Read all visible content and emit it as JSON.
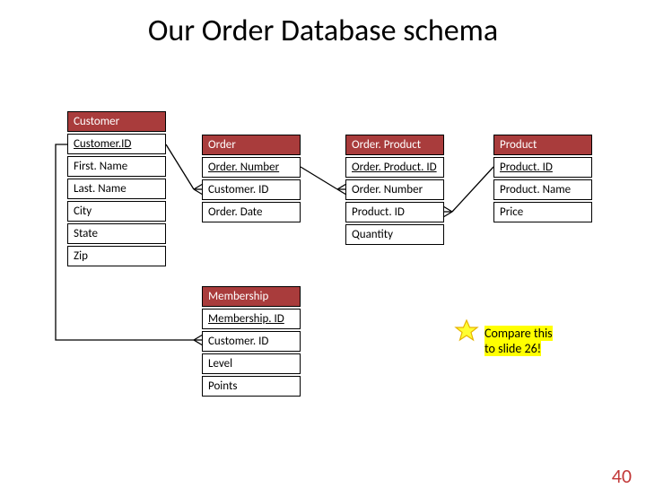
{
  "title": "Our Order Database schema",
  "tables": {
    "customer": {
      "name": "Customer",
      "fields": [
        "Customer.ID",
        "First. Name",
        "Last. Name",
        "City",
        "State",
        "Zip"
      ]
    },
    "order": {
      "name": "Order",
      "fields": [
        "Order. Number",
        "Customer. ID",
        "Order. Date"
      ]
    },
    "orderproduct": {
      "name": "Order. Product",
      "fields": [
        "Order. Product. ID",
        "Order. Number",
        "Product. ID",
        "Quantity"
      ]
    },
    "product": {
      "name": "Product",
      "fields": [
        "Product. ID",
        "Product. Name",
        "Price"
      ]
    },
    "membership": {
      "name": "Membership",
      "fields": [
        "Membership. ID",
        "Customer. ID",
        "Level",
        "Points"
      ]
    }
  },
  "note": {
    "line1": "Compare this",
    "line2": "to slide 26!"
  },
  "page_number": "40"
}
